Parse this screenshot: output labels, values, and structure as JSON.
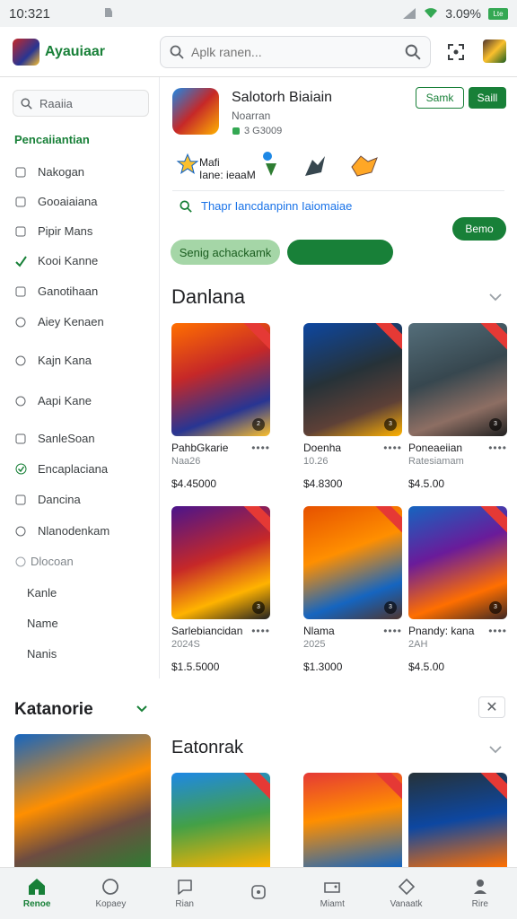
{
  "status": {
    "time": "10:321",
    "battery_text": "3.09%",
    "battery_badge": "Lte"
  },
  "header": {
    "app_name": "Ayauiaar",
    "search_placeholder": "Aplk ranen..."
  },
  "sidebar": {
    "search_placeholder": "Raaiia",
    "heading": "Pencaiiantian",
    "items": [
      {
        "label": "Nakogan",
        "icon": "square-icon"
      },
      {
        "label": "Gooaiaiana",
        "icon": "square-icon"
      },
      {
        "label": "Pipir Mans",
        "icon": "square-icon"
      },
      {
        "label": "Kooi Kanne",
        "icon": "check-icon"
      },
      {
        "label": "Ganotihaan",
        "icon": "square-icon"
      },
      {
        "label": "Aiey Kenaen",
        "icon": "circle-icon"
      },
      {
        "label": "Kajn Kana",
        "icon": "circle-icon"
      },
      {
        "label": "Aapi Kane",
        "icon": "circle-icon"
      },
      {
        "label": "SanleSoan",
        "icon": "square-icon"
      },
      {
        "label": "Encaplaciana",
        "icon": "check-circle-icon"
      },
      {
        "label": "Dancina",
        "icon": "square-icon"
      },
      {
        "label": "Nlanodenkam",
        "icon": "circle-icon"
      }
    ],
    "group_label": "Dlocoan",
    "sub_items": [
      "Kanle",
      "Name",
      "Nanis"
    ],
    "katanorie": "Katanorie"
  },
  "featured": {
    "title": "Salotorh Biaiain",
    "subtitle": "Noarran",
    "meta": "3 G3009",
    "btn_outline": "Samk",
    "btn_solid": "Saill",
    "feature_text_1": "Mafi",
    "feature_text_2": "Iane: ieaaM",
    "hint": "Thapr Iancdanpinn Iaiomaiae",
    "btn_green": "Bemo",
    "pill_light": "Senig achackamk"
  },
  "section1": {
    "title": "Danlana",
    "cards": [
      {
        "title": "PahbGkarie",
        "sub": "Naa26",
        "price": "$4.45000",
        "badge": "2"
      },
      {
        "title": "Doenha",
        "sub": "10.26",
        "price": "$4.8300",
        "badge": "3"
      },
      {
        "title": "Poneaeiian",
        "sub": "Ratesiamam",
        "price": "$4.5.00",
        "badge": "3"
      },
      {
        "title": "Sarlebiancidan",
        "sub": "2024S",
        "price": "$1.5.5000",
        "badge": "3"
      },
      {
        "title": "Nlama",
        "sub": "2025",
        "price": "$1.3000",
        "badge": "3"
      },
      {
        "title": "Pnandy: kana",
        "sub": "2AH",
        "price": "$4.5.00",
        "badge": "3"
      }
    ]
  },
  "section2": {
    "title": "Eatonrak"
  },
  "bottom_nav": [
    {
      "label": "Renoe",
      "icon": "home-icon",
      "active": true
    },
    {
      "label": "Kopaey",
      "icon": "compass-icon",
      "active": false
    },
    {
      "label": "Rian",
      "icon": "chat-icon",
      "active": false
    },
    {
      "label": "",
      "icon": "dot-icon",
      "active": false
    },
    {
      "label": "Miamt",
      "icon": "games-icon",
      "active": false
    },
    {
      "label": "Vanaatk",
      "icon": "diamond-icon",
      "active": false
    },
    {
      "label": "Rire",
      "icon": "person-icon",
      "active": false
    }
  ]
}
